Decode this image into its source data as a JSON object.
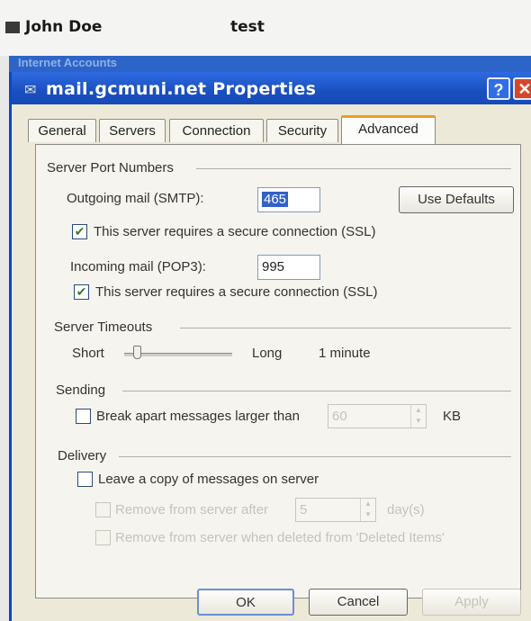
{
  "background_list": {
    "row1": {
      "name": "John Doe",
      "value": "test"
    }
  },
  "outer_window": {
    "title": "Internet Accounts"
  },
  "dialog": {
    "title": "mail.gcmuni.net Properties",
    "help_label": "?",
    "close_label": "✕",
    "tabs": [
      "General",
      "Servers",
      "Connection",
      "Security",
      "Advanced"
    ],
    "active_tab": "Advanced",
    "ports": {
      "group_label": "Server Port Numbers",
      "smtp_label": "Outgoing mail (SMTP):",
      "smtp_value": "465",
      "use_defaults_label": "Use Defaults",
      "smtp_ssl_label": "This server requires a secure connection (SSL)",
      "smtp_ssl_checked": true,
      "pop3_label": "Incoming mail (POP3):",
      "pop3_value": "995",
      "pop3_ssl_label": "This server requires a secure connection (SSL)",
      "pop3_ssl_checked": true
    },
    "timeouts": {
      "group_label": "Server Timeouts",
      "short_label": "Short",
      "long_label": "Long",
      "value_label": "1 minute"
    },
    "sending": {
      "group_label": "Sending",
      "break_label": "Break apart messages larger than",
      "break_checked": false,
      "break_value": "60",
      "unit_label": "KB"
    },
    "delivery": {
      "group_label": "Delivery",
      "leave_copy_label": "Leave a copy of messages on server",
      "leave_copy_checked": false,
      "remove_after_label": "Remove from server after",
      "remove_after_value": "5",
      "days_label": "day(s)",
      "remove_deleted_label": "Remove from server when deleted from 'Deleted Items'"
    },
    "buttons": {
      "ok": "OK",
      "cancel": "Cancel",
      "apply": "Apply"
    }
  },
  "colors": {
    "titlebar": "#1a4fc0",
    "tab_accent": "#e8a020",
    "selection": "#3161c9"
  },
  "icons": {
    "title_icon": "mail-account-icon",
    "checkbox": "check-icon"
  }
}
